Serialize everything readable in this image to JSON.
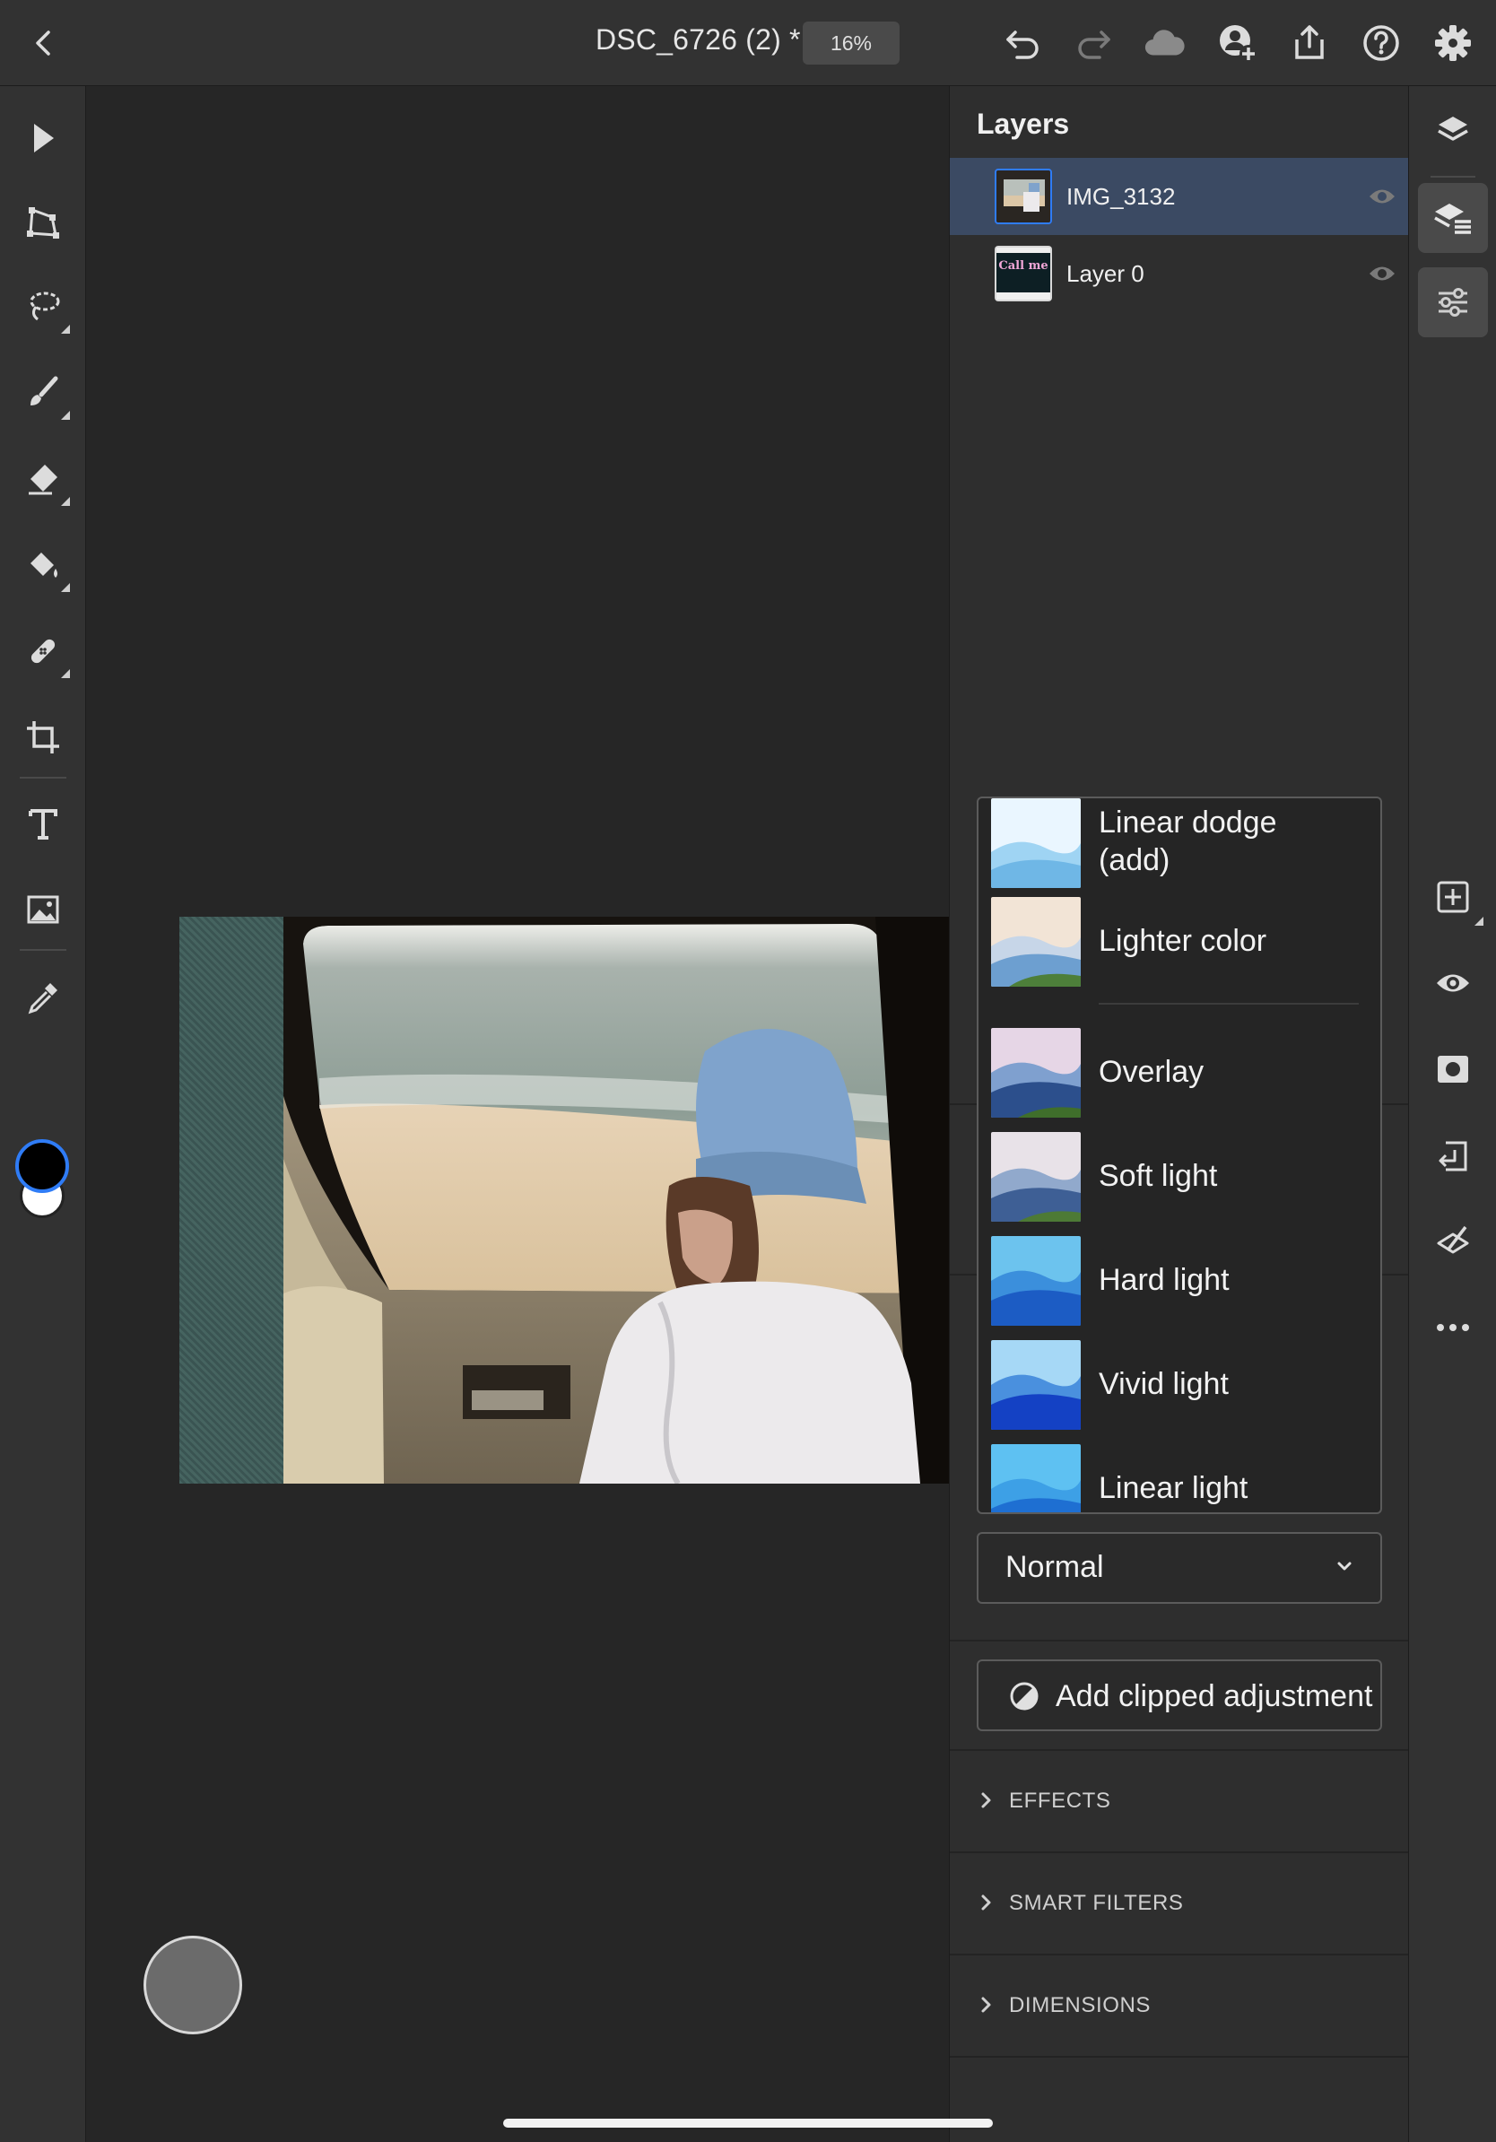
{
  "header": {
    "doc_title": "DSC_6726 (2) *",
    "zoom": "16%",
    "icons": [
      "back-icon",
      "undo-icon",
      "redo-icon",
      "cloud-icon",
      "invite-icon",
      "share-icon",
      "help-icon",
      "settings-icon"
    ]
  },
  "toolbar": {
    "tools": [
      "select-icon",
      "transform-icon",
      "lasso-icon",
      "brush-icon",
      "eraser-icon",
      "fill-icon",
      "healing-icon",
      "crop-icon",
      "type-icon",
      "place-image-icon",
      "eyedropper-icon"
    ],
    "foreground_color": "#000000",
    "background_color": "#ffffff",
    "accent": "#2f7cf6"
  },
  "layers_panel": {
    "title": "Layers",
    "layers": [
      {
        "name": "IMG_3132",
        "selected": true
      },
      {
        "name": "Layer 0",
        "selected": false
      }
    ],
    "layer0_thumb_text": "Call me"
  },
  "blend_modes": {
    "items": [
      "Linear dodge\n(add)",
      "Lighter color",
      "Overlay",
      "Soft light",
      "Hard light",
      "Vivid light",
      "Linear light"
    ],
    "selected": "Normal"
  },
  "properties": {
    "clip_button": "Add clipped adjustment",
    "sections": [
      "EFFECTS",
      "SMART FILTERS",
      "DIMENSIONS"
    ]
  },
  "rightbar": {
    "icons": [
      "layers-icon",
      "layer-properties-icon",
      "adjustments-icon",
      "add-layer-icon",
      "visibility-icon",
      "mask-icon",
      "import-icon",
      "clear-icon",
      "more-icon"
    ]
  }
}
